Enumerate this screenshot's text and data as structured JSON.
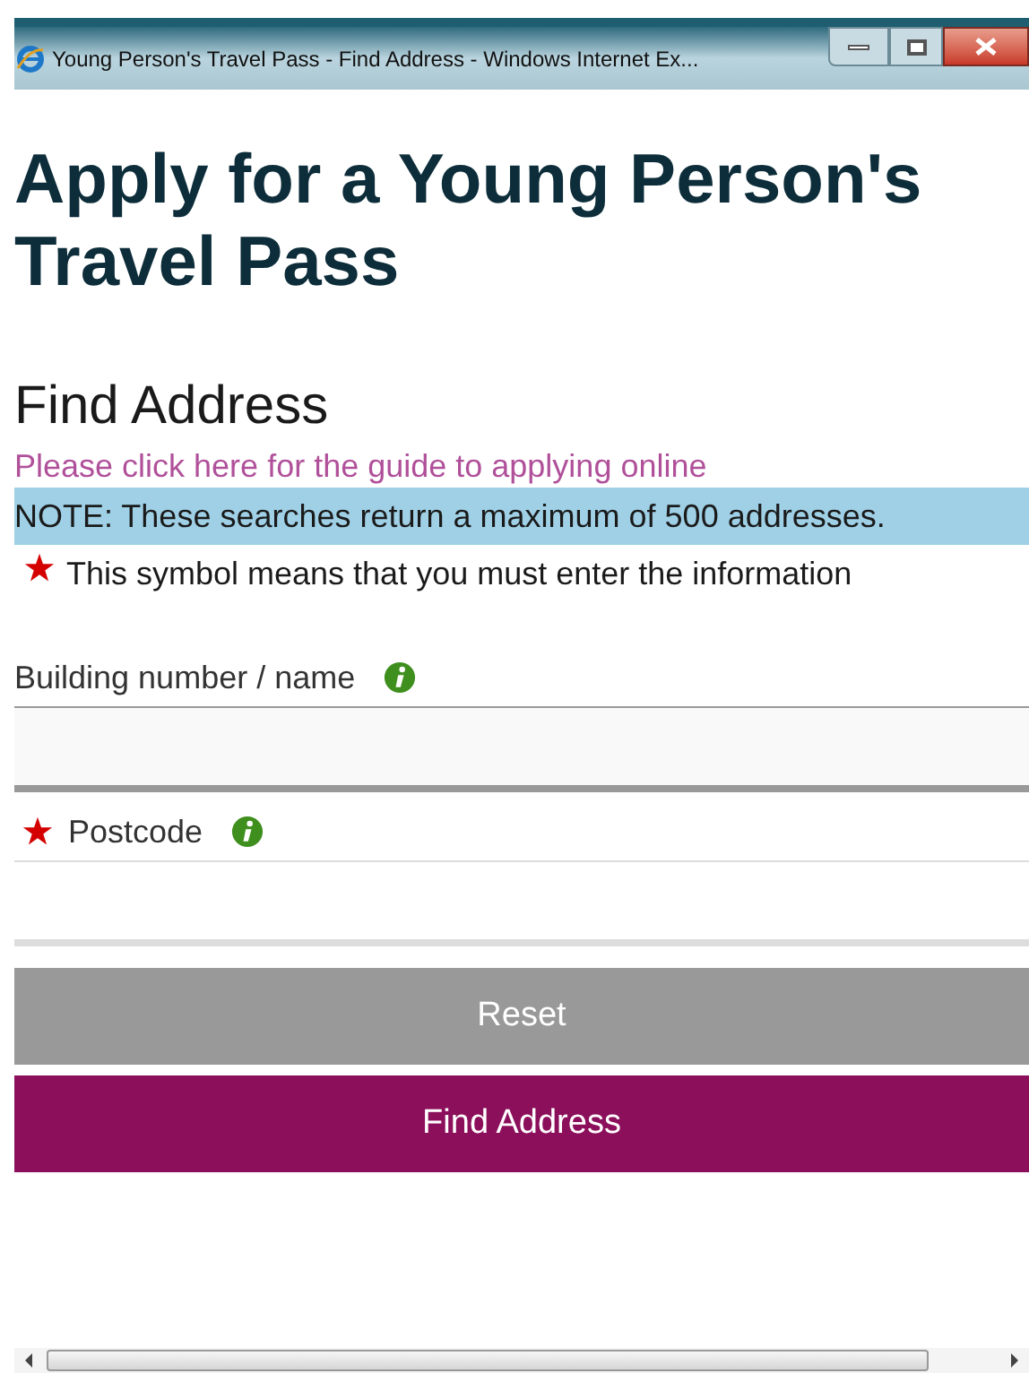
{
  "window": {
    "title": "Young Person's Travel Pass - Find Address - Windows Internet Ex..."
  },
  "heading": "Apply for a Young Person's Travel Pass",
  "subheading": "Find Address",
  "guide_link": "Please click here for the guide to applying online",
  "note": "NOTE: These searches return a maximum of 500 addresses.",
  "required_legend": "This symbol means that you must enter the information",
  "fields": [
    {
      "label": "Building number / name",
      "required": false,
      "kind": "shaded"
    },
    {
      "label": "Postcode",
      "required": true,
      "kind": "plain"
    }
  ],
  "buttons": [
    {
      "label": "Reset",
      "kind": "secondary"
    },
    {
      "label": "Find Address",
      "kind": "primary"
    }
  ]
}
